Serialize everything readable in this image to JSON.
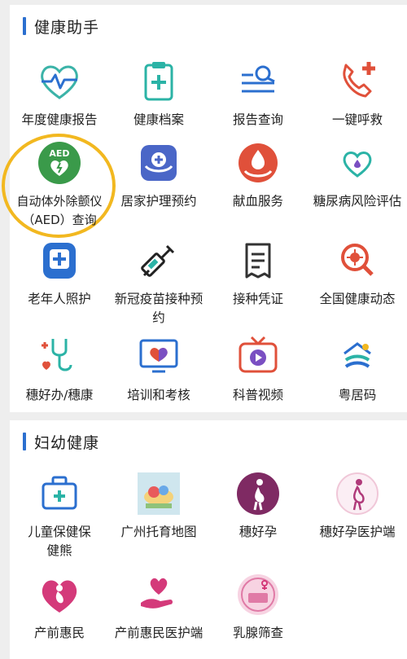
{
  "section_health": {
    "title": "健康助手",
    "items": [
      {
        "label": "年度健康报告",
        "icon": "heartbeat-icon"
      },
      {
        "label": "健康档案",
        "icon": "medical-record-icon"
      },
      {
        "label": "报告查询",
        "icon": "report-search-icon"
      },
      {
        "label": "一键呼救",
        "icon": "emergency-call-icon"
      },
      {
        "label": "自动体外除颤仪（AED）查询",
        "icon": "aed-icon",
        "badge": "AED"
      },
      {
        "label": "居家护理预约",
        "icon": "home-care-icon"
      },
      {
        "label": "献血服务",
        "icon": "blood-donation-icon"
      },
      {
        "label": "糖尿病风险评估",
        "icon": "diabetes-heart-icon"
      },
      {
        "label": "老年人照护",
        "icon": "elder-care-icon"
      },
      {
        "label": "新冠疫苗接种预约",
        "icon": "vaccine-syringe-icon"
      },
      {
        "label": "接种凭证",
        "icon": "certificate-icon"
      },
      {
        "label": "全国健康动态",
        "icon": "virus-search-icon"
      },
      {
        "label": "穗好办/穗康",
        "icon": "stethoscope-heart-icon"
      },
      {
        "label": "培训和考核",
        "icon": "training-heart-screen-icon"
      },
      {
        "label": "科普视频",
        "icon": "video-tv-icon"
      },
      {
        "label": "粤居码",
        "icon": "residence-code-icon"
      }
    ]
  },
  "section_women": {
    "title": "妇幼健康",
    "items": [
      {
        "label": "儿童保健保健熊",
        "icon": "first-aid-kit-icon"
      },
      {
        "label": "广州托育地图",
        "icon": "childcare-map-image-icon"
      },
      {
        "label": "穗好孕",
        "icon": "pregnancy-icon"
      },
      {
        "label": "穗好孕医护端",
        "icon": "pregnancy-outline-icon"
      },
      {
        "label": "产前惠民",
        "icon": "prenatal-heart-icon"
      },
      {
        "label": "产前惠民医护端",
        "icon": "hand-heart-icon"
      },
      {
        "label": "乳腺筛查",
        "icon": "breast-screening-icon"
      }
    ]
  },
  "colors": {
    "accent_blue": "#2b6fcf",
    "teal": "#2bb3a6",
    "red": "#e0503a",
    "purple": "#7f2a63",
    "aed_green": "#3a9a4a",
    "highlight_ring": "#f2b820"
  }
}
